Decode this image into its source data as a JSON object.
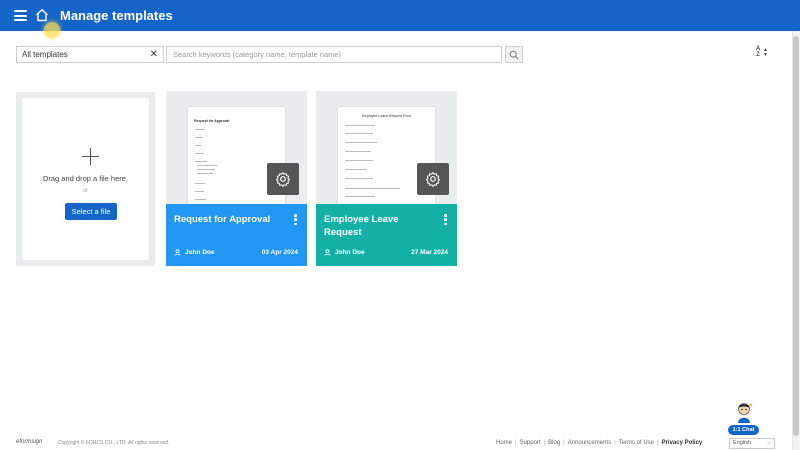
{
  "header": {
    "title": "Manage templates"
  },
  "toolbar": {
    "filter_value": "All templates",
    "search_placeholder": "Search keywords (category name, template name)",
    "sort_label_a": "A",
    "sort_label_z": "Z"
  },
  "upload": {
    "drag_text": "Drag and drop a file here.",
    "or_text": "or",
    "select_label": "Select a file"
  },
  "templates": [
    {
      "doc_title": "Request for Approval",
      "title": "Request for Approval",
      "author": "John Doe",
      "date": "03 Apr 2024",
      "color": "#2196f3"
    },
    {
      "doc_title": "Employee Leave Request Form",
      "title": "Employee Leave Request",
      "author": "John Doe",
      "date": "27 Mar 2024",
      "color": "#14b0a6"
    }
  ],
  "footer": {
    "logo": "eformsign",
    "copyright": "Copyright © FORCS CO., LTD. All rights reserved.",
    "links": [
      "Home",
      "Support",
      "Blog",
      "Announcements",
      "Terms of Use",
      "Privacy Policy"
    ],
    "language": "English"
  },
  "chat": {
    "label": "1:1 Chat"
  },
  "colors": {
    "primary": "#1565c9",
    "card_blue": "#2196f3",
    "card_teal": "#14b0a6"
  }
}
